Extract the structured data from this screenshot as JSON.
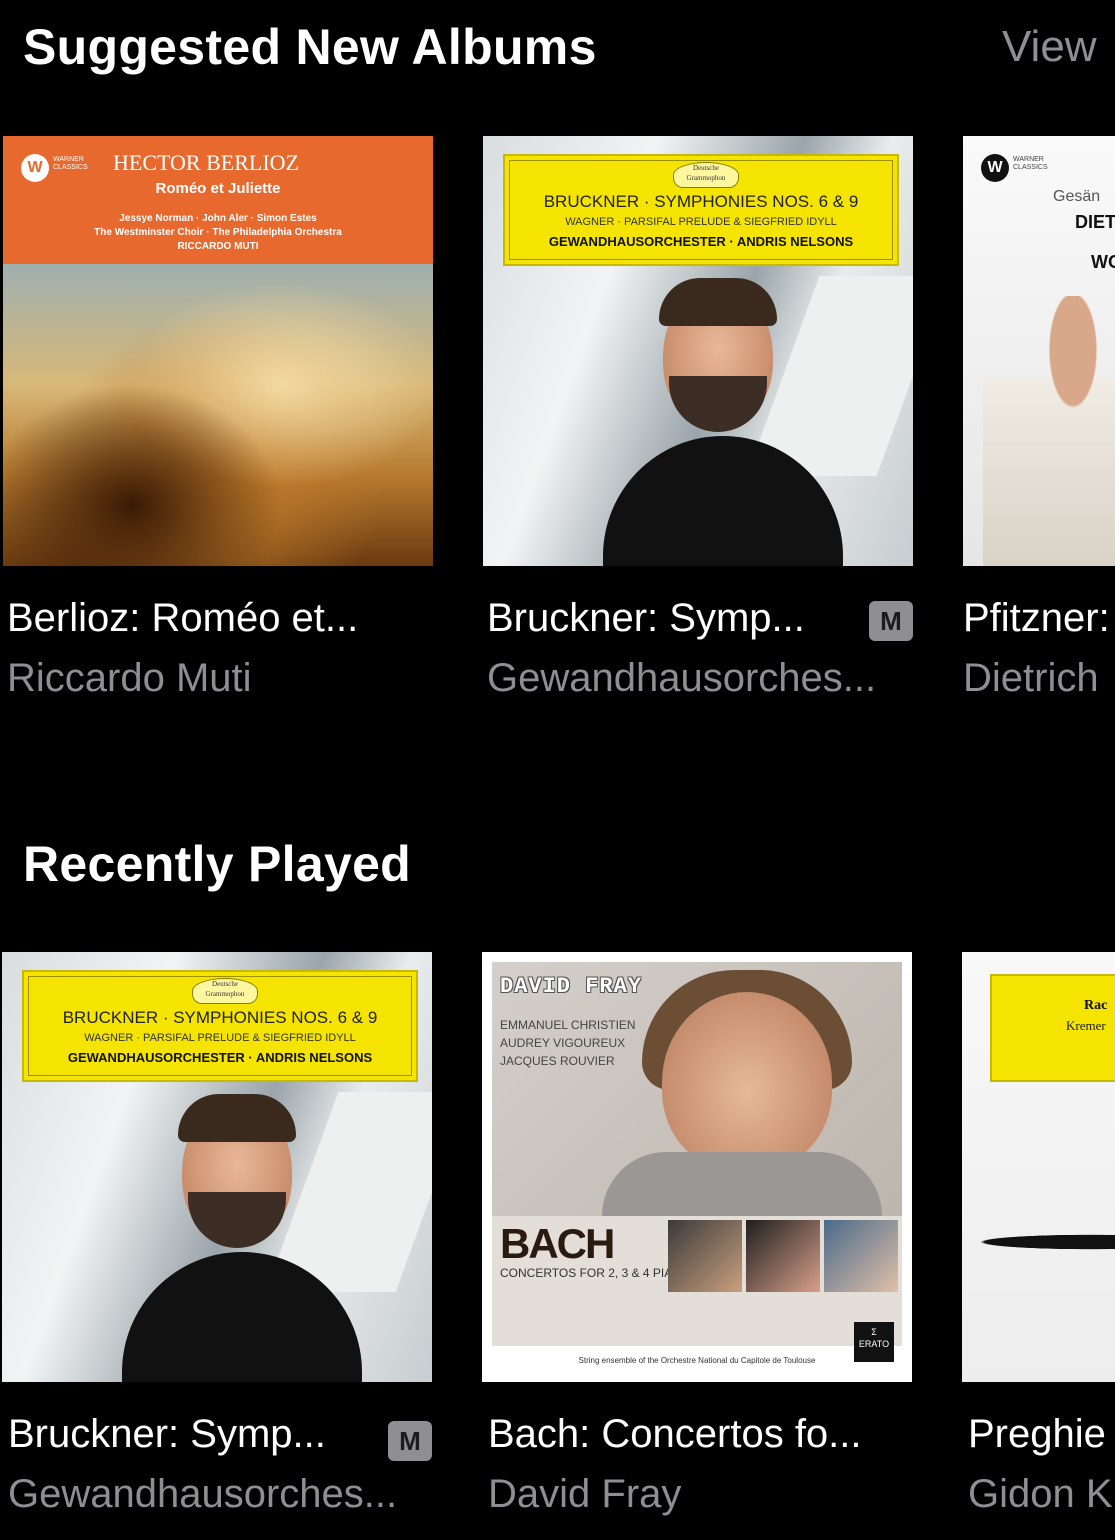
{
  "suggested": {
    "header": "Suggested New Albums",
    "view_all": "View",
    "albums": [
      {
        "title": "Berlioz: Roméo et...",
        "artist": "Riccardo Muti",
        "cover": {
          "label": "WARNER CLASSICS",
          "composer": "HECTOR BERLIOZ",
          "work": "Roméo et Juliette",
          "cast1": "Jessye Norman · John Aler · Simon Estes",
          "cast2": "The Westminster Choir · The Philadelphia Orchestra",
          "conductor": "RICCARDO MUTI"
        }
      },
      {
        "title": "Bruckner: Symp...",
        "artist": "Gewandhausorches...",
        "badge": "M",
        "cover": {
          "crest": "Deutsche Grammophon",
          "line1": "BRUCKNER · SYMPHONIES NOS. 6 & 9",
          "line2": "WAGNER · PARSIFAL PRELUDE & SIEGFRIED IDYLL",
          "line3": "GEWANDHAUSORCHESTER · ANDRIS NELSONS"
        }
      },
      {
        "title": "Pfitzner:",
        "artist": "Dietrich",
        "cover": {
          "label": "WARNER CLASSICS",
          "t1": "Gesän",
          "t2": "DIET",
          "t3": "WO"
        }
      }
    ]
  },
  "recent": {
    "header": "Recently Played",
    "albums": [
      {
        "title": "Bruckner: Symp...",
        "artist": "Gewandhausorches...",
        "badge": "M",
        "cover": {
          "crest": "Deutsche Grammophon",
          "line1": "BRUCKNER · SYMPHONIES NOS. 6 & 9",
          "line2": "WAGNER · PARSIFAL PRELUDE & SIEGFRIED IDYLL",
          "line3": "GEWANDHAUSORCHESTER · ANDRIS NELSONS"
        }
      },
      {
        "title": "Bach: Concertos fo...",
        "artist": "David Fray",
        "cover": {
          "name": "DAVID FRAY",
          "cast": [
            "EMMANUEL CHRISTIEN",
            "AUDREY VIGOUREUX",
            "JACQUES ROUVIER"
          ],
          "big": "BACH",
          "concertos": "CONCERTOS FOR 2, 3 & 4 PIANOS",
          "label": "ERATO",
          "footer": "String ensemble of the Orchestre National du Capitole de Toulouse"
        }
      },
      {
        "title": "Preghie",
        "artist": "Gidon K",
        "cover": {
          "t1": "Rac",
          "t2": "Kremer"
        }
      }
    ]
  },
  "colors": {
    "background": "#000000",
    "primary_text": "#ffffff",
    "secondary_text": "#8e8e93",
    "badge_bg": "#8e8e93",
    "dg_yellow": "#f5e400",
    "warner_orange": "#e8692e"
  }
}
